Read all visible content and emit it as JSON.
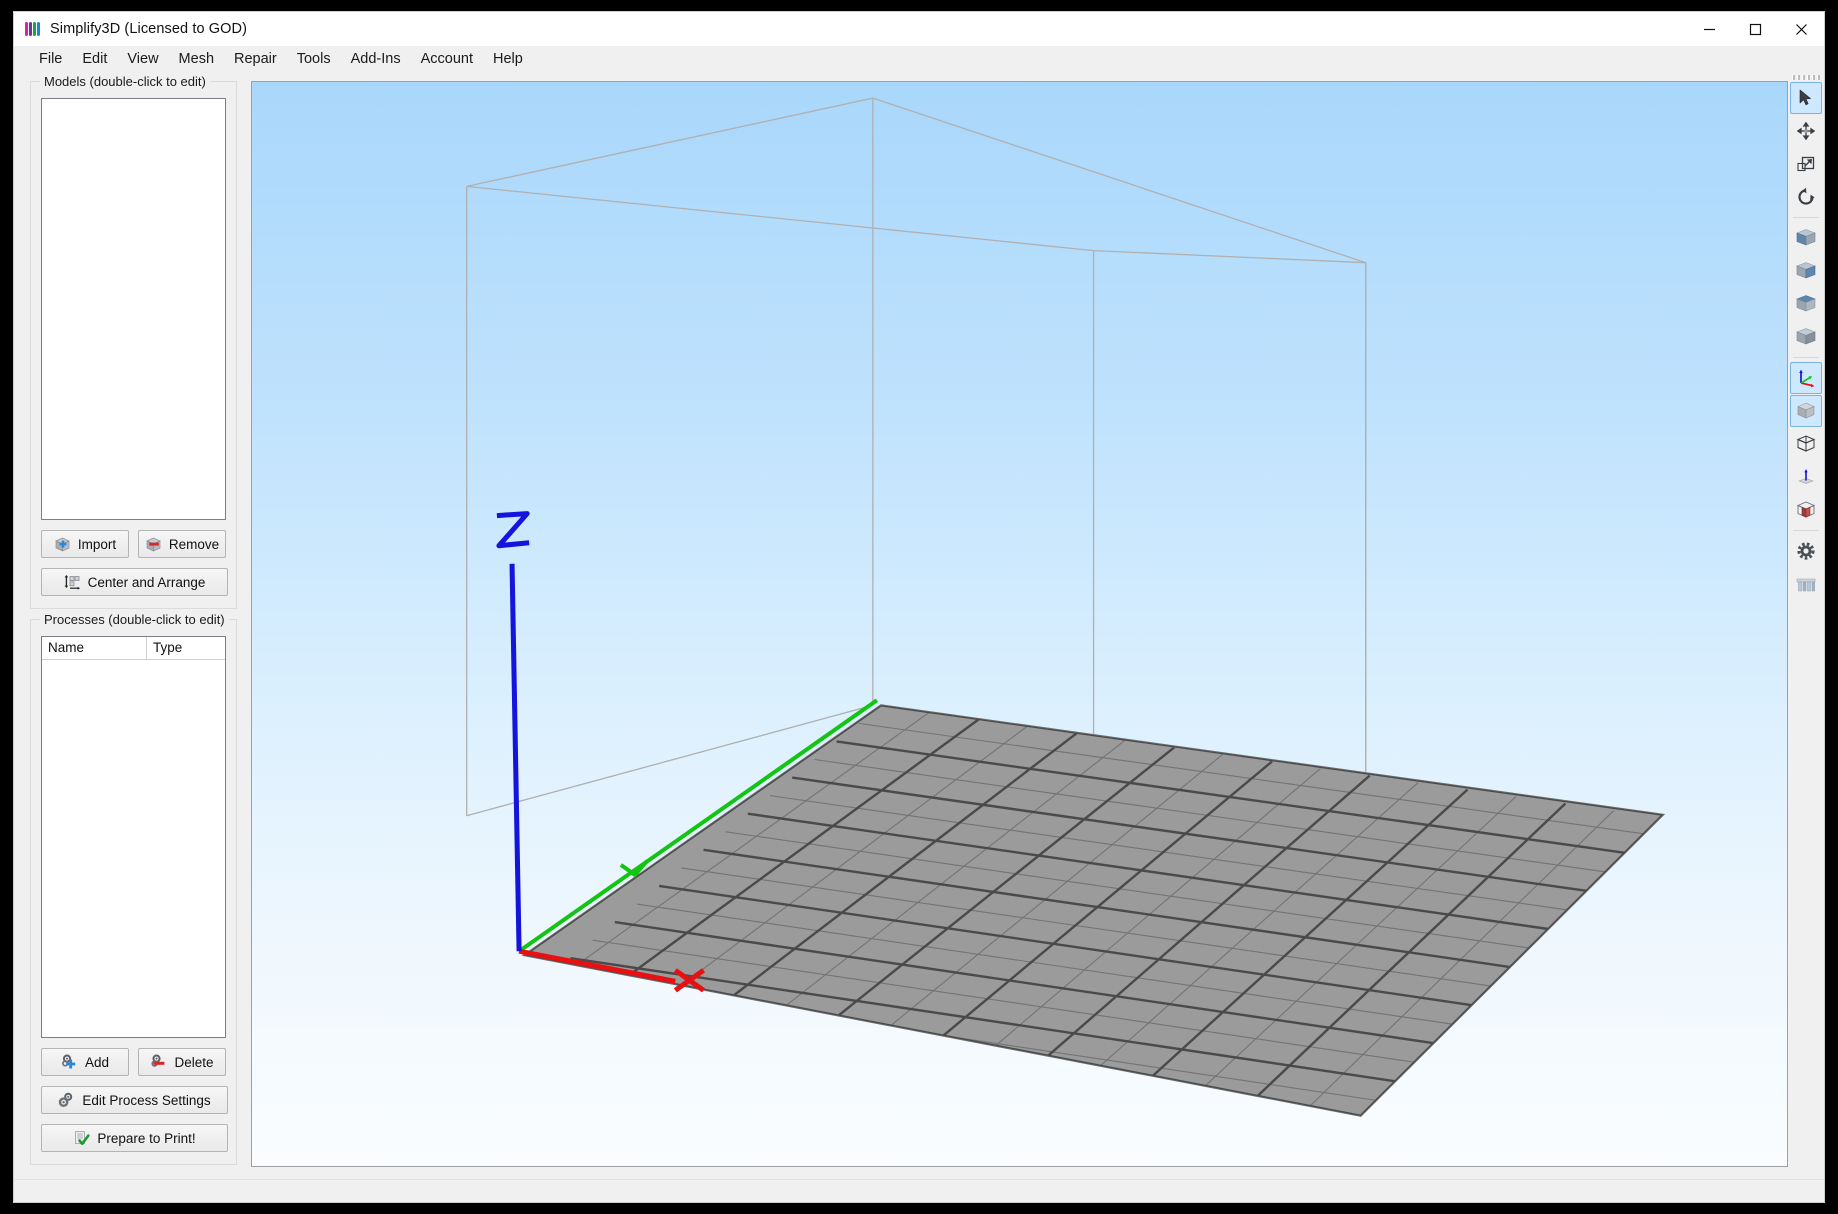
{
  "window": {
    "title": "Simplify3D (Licensed to GOD)",
    "app_icon": "simplify3d-logo-icon",
    "controls": {
      "minimize": "minimize-icon",
      "maximize": "maximize-icon",
      "close": "close-icon"
    }
  },
  "menubar": {
    "items": [
      {
        "label": "File"
      },
      {
        "label": "Edit"
      },
      {
        "label": "View"
      },
      {
        "label": "Mesh"
      },
      {
        "label": "Repair"
      },
      {
        "label": "Tools"
      },
      {
        "label": "Add-Ins"
      },
      {
        "label": "Account"
      },
      {
        "label": "Help"
      }
    ]
  },
  "models_panel": {
    "title": "Models (double-click to edit)",
    "items": [],
    "buttons": {
      "import": "Import",
      "remove": "Remove",
      "center_and_arrange": "Center and Arrange"
    }
  },
  "processes_panel": {
    "title": "Processes (double-click to edit)",
    "columns": [
      "Name",
      "Type"
    ],
    "rows": [],
    "buttons": {
      "add": "Add",
      "delete": "Delete",
      "edit_process_settings": "Edit Process Settings",
      "prepare_to_print": "Prepare to Print!"
    }
  },
  "viewport": {
    "axis_labels": {
      "x": "X",
      "y": "",
      "z": "Z"
    },
    "colors": {
      "background_top": "#a9d7fb",
      "background_bottom": "#fafcfe",
      "bed_fill": "#9b9b9b",
      "bed_grid": "#5f5f5f",
      "build_volume_edge": "#b3b3b3",
      "axis_x": "#e81010",
      "axis_y": "#12c512",
      "axis_z": "#1414dc"
    }
  },
  "toolstrip": {
    "grip": "drag-grip-icon",
    "tools": [
      {
        "name": "select-tool",
        "icon": "cursor-arrow-icon",
        "active": true
      },
      {
        "name": "move-tool",
        "icon": "move-arrows-icon",
        "active": false
      },
      {
        "name": "scale-tool",
        "icon": "scale-icon",
        "active": false
      },
      {
        "name": "rotate-tool",
        "icon": "rotate-icon",
        "active": false
      },
      {
        "name": "view-front",
        "icon": "cube-front-icon",
        "active": false
      },
      {
        "name": "view-side",
        "icon": "cube-side-icon",
        "active": false
      },
      {
        "name": "view-top",
        "icon": "cube-top-icon",
        "active": false
      },
      {
        "name": "view-iso",
        "icon": "cube-iso-icon",
        "active": false
      },
      {
        "name": "show-axes",
        "icon": "axes-icon",
        "active": true
      },
      {
        "name": "solid-view",
        "icon": "solid-cube-icon",
        "active": true
      },
      {
        "name": "wireframe-view",
        "icon": "wireframe-cube-icon",
        "active": false
      },
      {
        "name": "normals-view",
        "icon": "normal-vector-icon",
        "active": false
      },
      {
        "name": "cross-section-view",
        "icon": "cross-section-icon",
        "active": false
      },
      {
        "name": "machine-settings",
        "icon": "gear-icon",
        "active": false
      },
      {
        "name": "supports",
        "icon": "supports-icon",
        "active": false
      }
    ]
  }
}
